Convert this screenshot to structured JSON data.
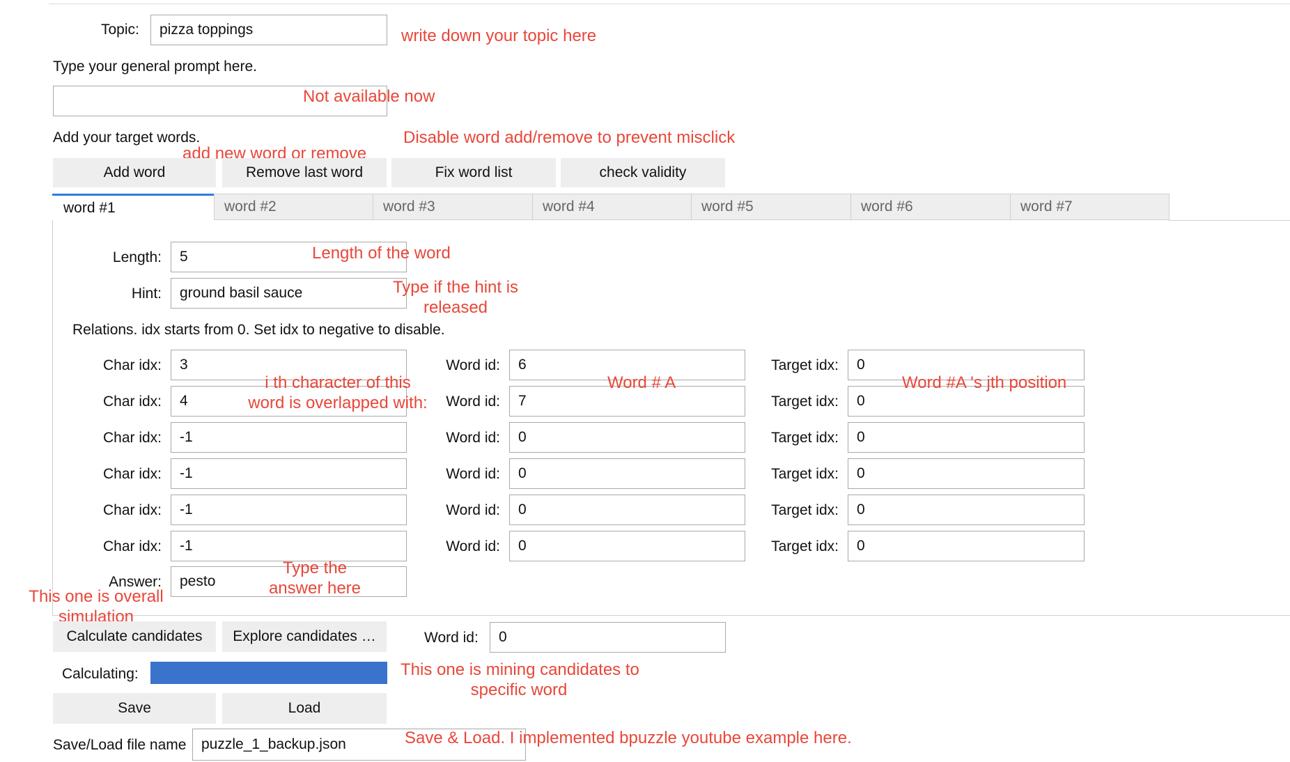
{
  "topic": {
    "label": "Topic:",
    "value": "pizza toppings"
  },
  "general_prompt": {
    "label": "Type your general prompt here.",
    "value": ""
  },
  "target_words": {
    "label": "Add your target words.",
    "buttons": [
      "Add word",
      "Remove last word",
      "Fix word list",
      "check validity"
    ]
  },
  "tabs": [
    "word #1",
    "word #2",
    "word #3",
    "word #4",
    "word #5",
    "word #6",
    "word #7"
  ],
  "word_panel": {
    "length_label": "Length:",
    "length_value": "5",
    "hint_label": "Hint:",
    "hint_value": "ground basil sauce",
    "relations_note": "Relations. idx starts from 0. Set idx to negative to disable.",
    "char_idx_label": "Char idx:",
    "word_id_label": "Word id:",
    "target_idx_label": "Target idx:",
    "relations": [
      {
        "char_idx": "3",
        "word_id": "6",
        "target_idx": "0"
      },
      {
        "char_idx": "4",
        "word_id": "7",
        "target_idx": "0"
      },
      {
        "char_idx": "-1",
        "word_id": "0",
        "target_idx": "0"
      },
      {
        "char_idx": "-1",
        "word_id": "0",
        "target_idx": "0"
      },
      {
        "char_idx": "-1",
        "word_id": "0",
        "target_idx": "0"
      },
      {
        "char_idx": "-1",
        "word_id": "0",
        "target_idx": "0"
      }
    ],
    "answer_label": "Answer:",
    "answer_value": "pesto"
  },
  "candidates": {
    "calculate_label": "Calculate candidates",
    "explore_label": "Explore candidates …",
    "word_id_label": "Word id:",
    "word_id_value": "0",
    "calculating_label": "Calculating:",
    "progress": 1.0,
    "progress_color": "#3a73cc"
  },
  "save_load": {
    "save_label": "Save",
    "load_label": "Load",
    "filename_label": "Save/Load file name",
    "filename_value": "puzzle_1_backup.json"
  },
  "annotations": {
    "topic": "write down your topic here",
    "prompt": "Not available now",
    "disable": "Disable word add/remove to prevent misclick",
    "add_remove": "add new word or remove",
    "length": "Length of the word",
    "hint_1": "Type if the hint is",
    "hint_2": "released",
    "ith_1": "i th character of this",
    "ith_2": "word is overlapped with:",
    "word_a": "Word # A",
    "word_a_pos": "Word #A 's jth position",
    "answer_1": "Type the",
    "answer_2": "answer here",
    "overall_1": "This one is overall",
    "overall_2": "simulation",
    "mining_1": "This one is mining candidates to",
    "mining_2": "specific word",
    "save_load": "Save & Load. I implemented bpuzzle youtube example here."
  },
  "annotation_color": "#e8473a"
}
